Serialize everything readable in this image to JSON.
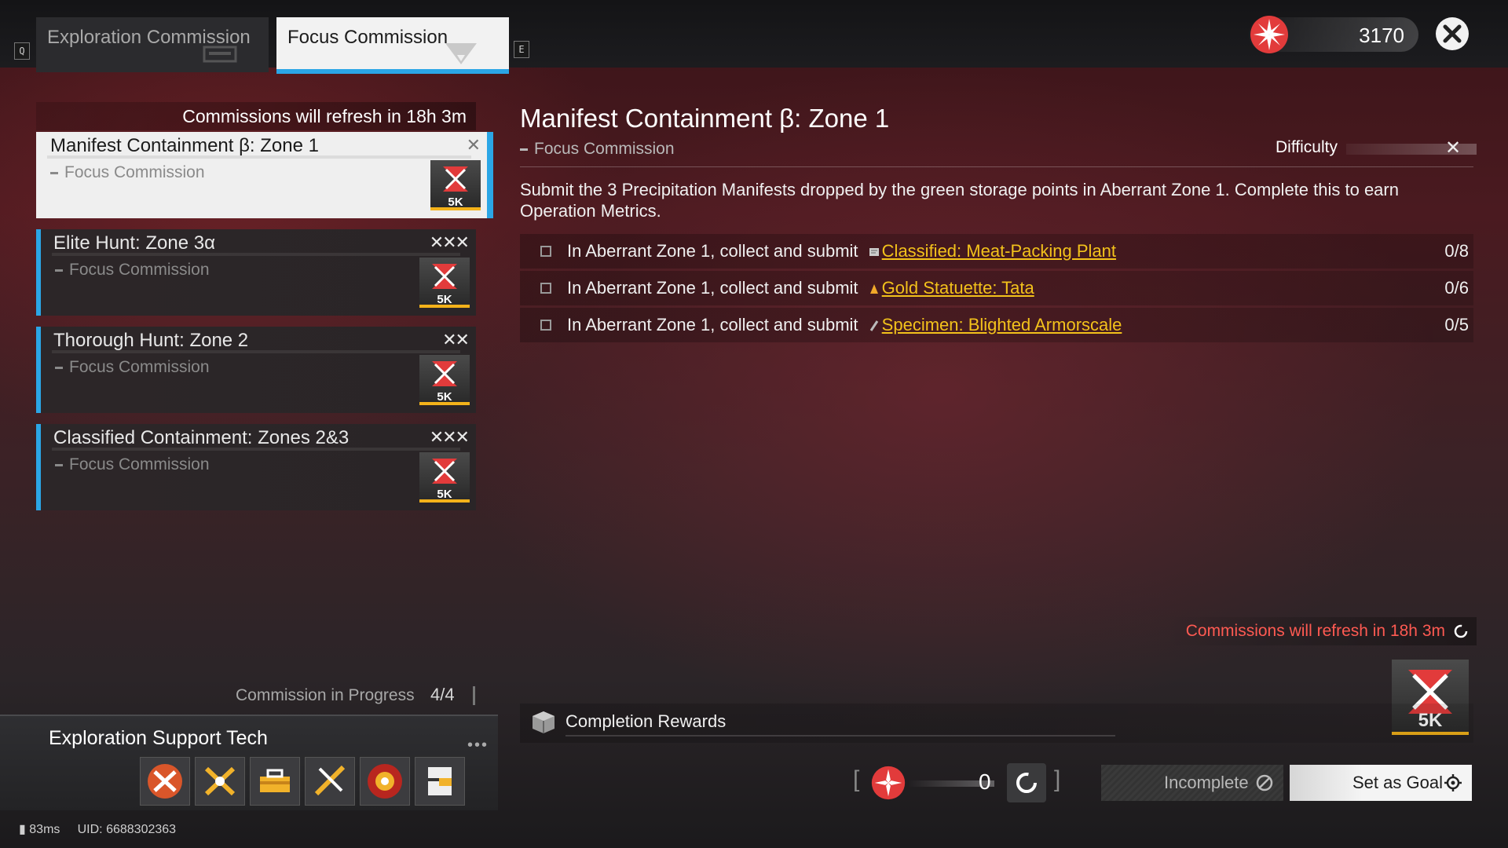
{
  "header": {
    "key_left": "Q",
    "key_right": "E",
    "tabs": [
      {
        "label": "Exploration Commission"
      },
      {
        "label": "Focus Commission"
      }
    ],
    "currency_value": "3170"
  },
  "list": {
    "refresh_text": "Commissions will refresh in 18h 3m",
    "cards": [
      {
        "title": "Manifest Containment β: Zone 1",
        "subtitle": "Focus Commission",
        "difficulty": "✕",
        "reward": "5K"
      },
      {
        "title": "Elite Hunt: Zone 3α",
        "subtitle": "Focus Commission",
        "difficulty": "✕✕✕",
        "reward": "5K"
      },
      {
        "title": "Thorough Hunt: Zone 2",
        "subtitle": "Focus Commission",
        "difficulty": "✕✕",
        "reward": "5K"
      },
      {
        "title": "Classified Containment: Zones 2&3",
        "subtitle": "Focus Commission",
        "difficulty": "✕✕✕",
        "reward": "5K"
      }
    ],
    "progress_label": "Commission in Progress",
    "progress_value": "4/4"
  },
  "support": {
    "title": "Exploration Support Tech",
    "dots": "•••"
  },
  "status": {
    "ping": "83ms",
    "uid": "UID: 6688302363"
  },
  "detail": {
    "title": "Manifest Containment β: Zone 1",
    "subtitle": "Focus Commission",
    "difficulty_label": "Difficulty",
    "difficulty_value": "✕",
    "description": "Submit the 3 Precipitation Manifests dropped by the green storage points in Aberrant Zone 1. Complete this to earn Operation Metrics.",
    "objectives": [
      {
        "text": "In Aberrant Zone 1, collect and submit",
        "item": "Classified: Meat-Packing Plant",
        "count": "0/8"
      },
      {
        "text": "In Aberrant Zone 1, collect and submit",
        "item": "Gold Statuette: Tata",
        "count": "0/6"
      },
      {
        "text": "In Aberrant Zone 1, collect and submit",
        "item": "Specimen: Blighted Armorscale",
        "count": "0/5"
      }
    ],
    "refresh_note": "Commissions will refresh in 18h 3m",
    "reward_amount": "5K",
    "rewards_label": "Completion Rewards",
    "cost_value": "0",
    "btn_incomplete": "Incomplete",
    "btn_goal": "Set as Goal"
  },
  "colors": {
    "accent_blue": "#2ba6e6",
    "accent_gold": "#f3b21a",
    "warning_red": "#ff5a52",
    "reward_red": "#e23b3b"
  }
}
